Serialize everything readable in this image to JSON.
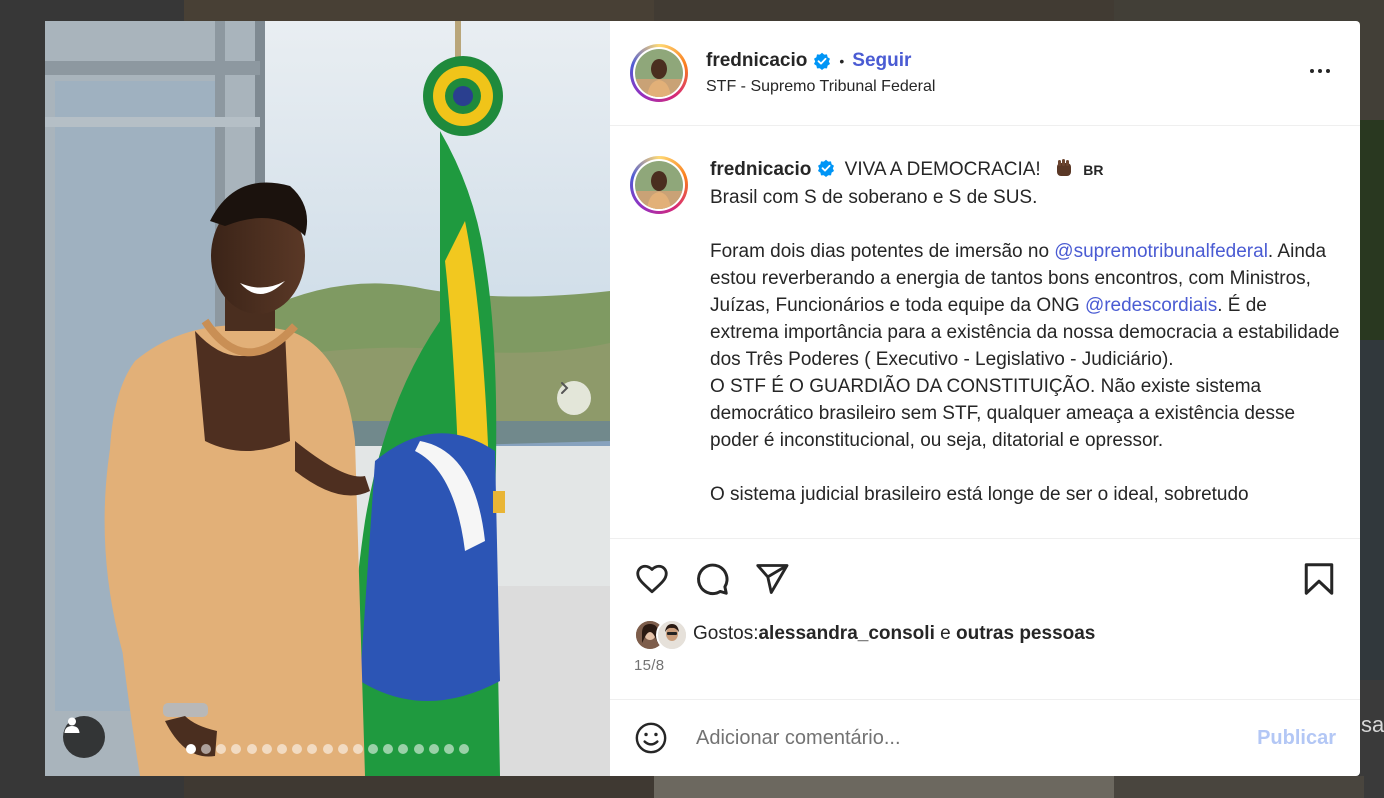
{
  "post": {
    "username": "frednicacio",
    "follow_label": "Seguir",
    "location": "STF - Supremo Tribunal Federal",
    "more_label": "Mais opções"
  },
  "caption": {
    "username": "frednicacio",
    "line1_text": "VIVA A DEMOCRACIA!",
    "flag_text": "BR",
    "line2": "Brasil com S de soberano e S de SUS.",
    "p2_before": "Foram dois dias potentes de imersão no ",
    "mention1": "@supremotribunalfederal",
    "p2_mid": ". Ainda estou reverberando a energia de tantos bons encontros, com Ministros, Juízas, Funcionários e toda equipe da ONG ",
    "mention2": "@redescordiais",
    "p2_after": ". É de extrema importância para a existência da nossa democracia a estabilidade dos Três Poderes ( Executivo - Legislativo - Judiciário).",
    "p3": "O STF É O GUARDIÃO DA CONSTITUIÇÃO. Não existe sistema democrático brasileiro sem STF, qualquer ameaça a existência desse poder é inconstitucional, ou seja, ditatorial e opressor.",
    "p4": "O sistema judicial brasileiro está longe de ser o ideal, sobretudo"
  },
  "likes": {
    "prefix": "Gostos: ",
    "user": "alessandra_consoli",
    "connector": " e ",
    "others": "outras pessoas"
  },
  "date": "15/8",
  "comment": {
    "placeholder": "Adicionar comentário...",
    "publish_label": "Publicar"
  },
  "background_texts": {
    "right_fragment": "sag"
  },
  "carousel": {
    "slides": 19,
    "active_index": 0
  },
  "colors": {
    "link": "#4a5bd3",
    "publish_disabled": "#b3c7f5",
    "verified": "#0095f6"
  },
  "icons": [
    "heart-icon",
    "comment-icon",
    "share-icon",
    "bookmark-icon",
    "emoji-icon",
    "user-tag-icon",
    "chevron-right-icon",
    "verified-icon"
  ]
}
